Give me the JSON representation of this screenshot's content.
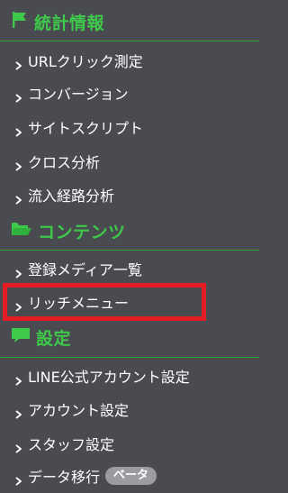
{
  "sections": {
    "stats": {
      "title": "統計情報",
      "icon": "flag-icon",
      "items": [
        {
          "label": "URLクリック測定"
        },
        {
          "label": "コンバージョン"
        },
        {
          "label": "サイトスクリプト"
        },
        {
          "label": "クロス分析"
        },
        {
          "label": "流入経路分析"
        }
      ]
    },
    "contents": {
      "title": "コンテンツ",
      "icon": "folder-icon",
      "items": [
        {
          "label": "登録メディア一覧"
        },
        {
          "label": "リッチメニュー"
        }
      ]
    },
    "settings": {
      "title": "設定",
      "icon": "chat-bubble-icon",
      "items": [
        {
          "label": "LINE公式アカウント設定"
        },
        {
          "label": "アカウント設定"
        },
        {
          "label": "スタッフ設定"
        },
        {
          "label": "データ移行",
          "badge": "ベータ"
        }
      ]
    }
  },
  "colors": {
    "background": "#494b50",
    "accent_green": "#3ec94a",
    "highlight_red": "#e31b22",
    "badge_gray": "#9a9ca1"
  }
}
